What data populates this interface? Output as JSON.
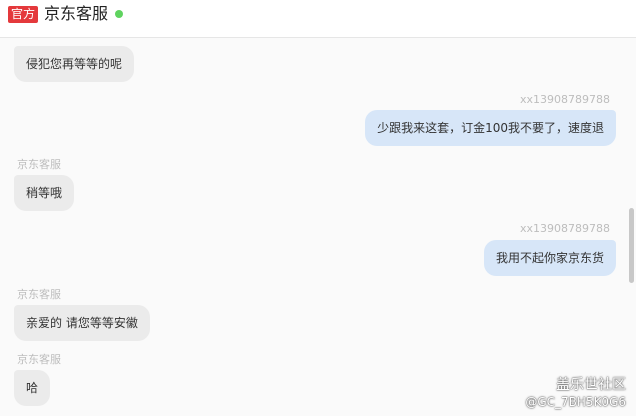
{
  "header": {
    "badge": "官方",
    "title": "京东客服",
    "status_color": "#5fd35f"
  },
  "messages": [
    {
      "side": "left",
      "sender": "",
      "text": "侵犯您再等等的呢"
    },
    {
      "side": "right",
      "sender": "xx13908789788",
      "text": "少跟我来这套，订金100我不要了，速度退"
    },
    {
      "side": "left",
      "sender": "京东客服",
      "text": "稍等哦"
    },
    {
      "side": "right",
      "sender": "xx13908789788",
      "text": "我用不起你家京东货"
    },
    {
      "side": "left",
      "sender": "京东客服",
      "text": "亲爱的 请您等等安徽"
    },
    {
      "side": "left",
      "sender": "京东客服",
      "text": "哈"
    }
  ],
  "watermark": {
    "line1": "盖乐世社区",
    "line2": "@GC_7BH5K0G6"
  }
}
